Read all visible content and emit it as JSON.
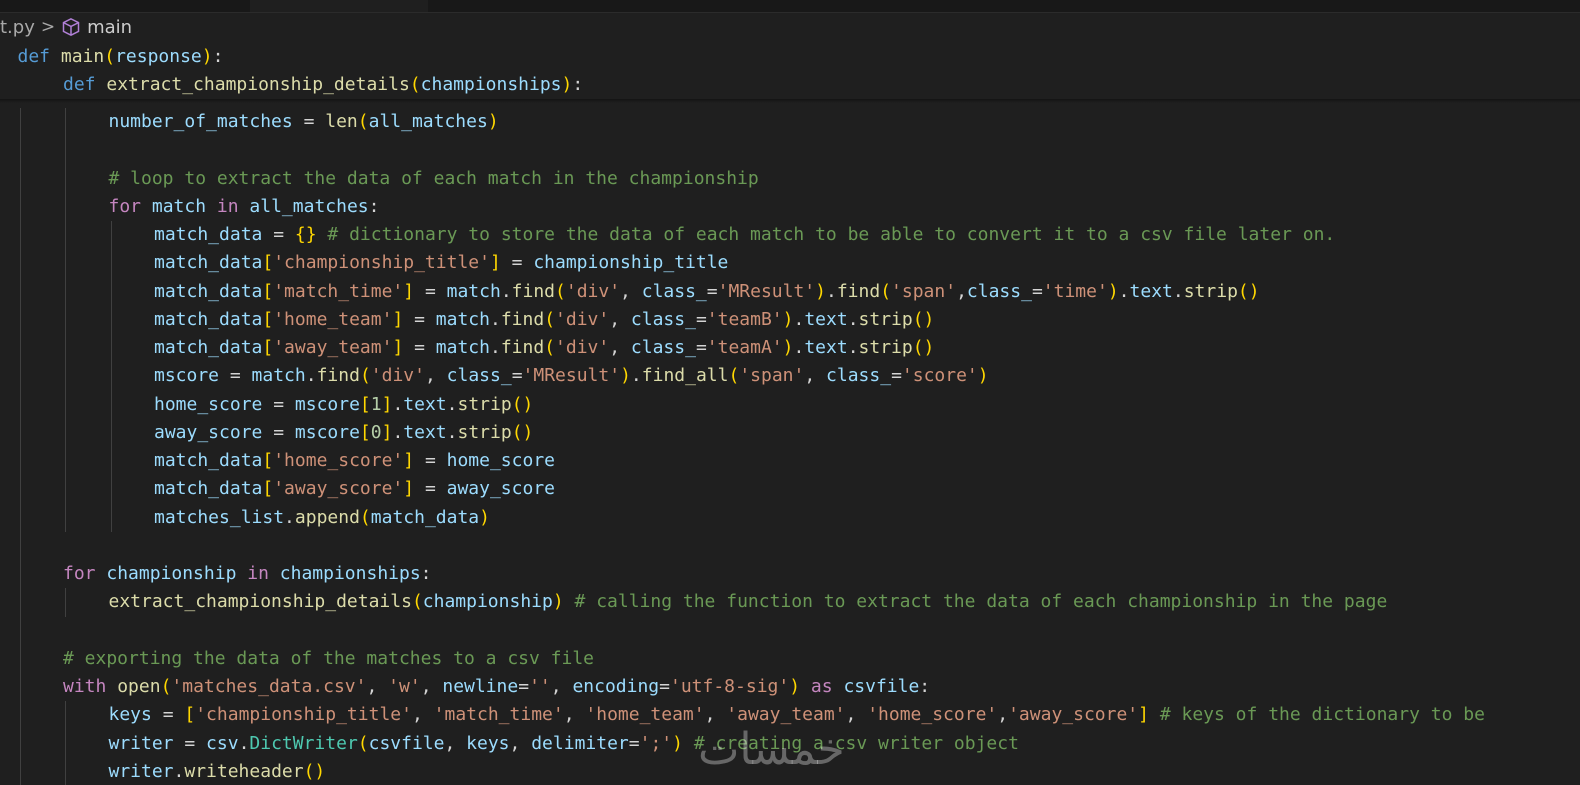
{
  "breadcrumb": {
    "file": "t.py",
    "symbol": "main",
    "separator": ">"
  },
  "colors": {
    "keyword": "#569cd6",
    "control": "#c586c0",
    "function": "#dcdcaa",
    "variable": "#9cdcfe",
    "string": "#ce9178",
    "comment": "#6a9955",
    "number": "#b5cea8",
    "bracket1": "#ffd700",
    "bracket2": "#da70d6",
    "class": "#4ec9b0",
    "background": "#1f1f1f"
  },
  "watermark": "خمسات",
  "sticky_lines": [
    {
      "indent": 1,
      "tokens": [
        [
          "kw",
          "def"
        ],
        [
          "op",
          " "
        ],
        [
          "fn",
          "main"
        ],
        [
          "p1",
          "("
        ],
        [
          "var",
          "response"
        ],
        [
          "p1",
          ")"
        ],
        [
          "op",
          ":"
        ]
      ]
    },
    {
      "indent": 2,
      "tokens": [
        [
          "kw",
          "def"
        ],
        [
          "op",
          " "
        ],
        [
          "fn",
          "extract_championship_details"
        ],
        [
          "p1",
          "("
        ],
        [
          "var",
          "championships"
        ],
        [
          "p1",
          ")"
        ],
        [
          "op",
          ":"
        ]
      ]
    }
  ],
  "code_lines": [
    {
      "indent": 3,
      "tokens": [
        [
          "var",
          "number_of_matches"
        ],
        [
          "op",
          " = "
        ],
        [
          "fn",
          "len"
        ],
        [
          "p1",
          "("
        ],
        [
          "var",
          "all_matches"
        ],
        [
          "p1",
          ")"
        ]
      ]
    },
    {
      "indent": 0,
      "tokens": []
    },
    {
      "indent": 3,
      "tokens": [
        [
          "cmt",
          "# loop to extract the data of each match in the championship"
        ]
      ]
    },
    {
      "indent": 3,
      "tokens": [
        [
          "ctl",
          "for"
        ],
        [
          "op",
          " "
        ],
        [
          "var",
          "match"
        ],
        [
          "op",
          " "
        ],
        [
          "ctl",
          "in"
        ],
        [
          "op",
          " "
        ],
        [
          "var",
          "all_matches"
        ],
        [
          "op",
          ":"
        ]
      ]
    },
    {
      "indent": 4,
      "tokens": [
        [
          "var",
          "match_data"
        ],
        [
          "op",
          " = "
        ],
        [
          "p1",
          "{}"
        ],
        [
          "op",
          " "
        ],
        [
          "cmt",
          "# dictionary to store the data of each match to be able to convert it to a csv file later on."
        ]
      ]
    },
    {
      "indent": 4,
      "tokens": [
        [
          "var",
          "match_data"
        ],
        [
          "p1",
          "["
        ],
        [
          "str",
          "'championship_title'"
        ],
        [
          "p1",
          "]"
        ],
        [
          "op",
          " = "
        ],
        [
          "var",
          "championship_title"
        ]
      ]
    },
    {
      "indent": 4,
      "tokens": [
        [
          "var",
          "match_data"
        ],
        [
          "p1",
          "["
        ],
        [
          "str",
          "'match_time'"
        ],
        [
          "p1",
          "]"
        ],
        [
          "op",
          " = "
        ],
        [
          "var",
          "match"
        ],
        [
          "op",
          "."
        ],
        [
          "fn",
          "find"
        ],
        [
          "p1",
          "("
        ],
        [
          "str",
          "'div'"
        ],
        [
          "op",
          ", "
        ],
        [
          "var",
          "class_"
        ],
        [
          "op",
          "="
        ],
        [
          "str",
          "'MResult'"
        ],
        [
          "p1",
          ")"
        ],
        [
          "op",
          "."
        ],
        [
          "fn",
          "find"
        ],
        [
          "p1",
          "("
        ],
        [
          "str",
          "'span'"
        ],
        [
          "op",
          ","
        ],
        [
          "var",
          "class_"
        ],
        [
          "op",
          "="
        ],
        [
          "str",
          "'time'"
        ],
        [
          "p1",
          ")"
        ],
        [
          "op",
          "."
        ],
        [
          "var",
          "text"
        ],
        [
          "op",
          "."
        ],
        [
          "fn",
          "strip"
        ],
        [
          "p1",
          "()"
        ]
      ]
    },
    {
      "indent": 4,
      "tokens": [
        [
          "var",
          "match_data"
        ],
        [
          "p1",
          "["
        ],
        [
          "str",
          "'home_team'"
        ],
        [
          "p1",
          "]"
        ],
        [
          "op",
          " = "
        ],
        [
          "var",
          "match"
        ],
        [
          "op",
          "."
        ],
        [
          "fn",
          "find"
        ],
        [
          "p1",
          "("
        ],
        [
          "str",
          "'div'"
        ],
        [
          "op",
          ", "
        ],
        [
          "var",
          "class_"
        ],
        [
          "op",
          "="
        ],
        [
          "str",
          "'teamB'"
        ],
        [
          "p1",
          ")"
        ],
        [
          "op",
          "."
        ],
        [
          "var",
          "text"
        ],
        [
          "op",
          "."
        ],
        [
          "fn",
          "strip"
        ],
        [
          "p1",
          "()"
        ]
      ]
    },
    {
      "indent": 4,
      "tokens": [
        [
          "var",
          "match_data"
        ],
        [
          "p1",
          "["
        ],
        [
          "str",
          "'away_team'"
        ],
        [
          "p1",
          "]"
        ],
        [
          "op",
          " = "
        ],
        [
          "var",
          "match"
        ],
        [
          "op",
          "."
        ],
        [
          "fn",
          "find"
        ],
        [
          "p1",
          "("
        ],
        [
          "str",
          "'div'"
        ],
        [
          "op",
          ", "
        ],
        [
          "var",
          "class_"
        ],
        [
          "op",
          "="
        ],
        [
          "str",
          "'teamA'"
        ],
        [
          "p1",
          ")"
        ],
        [
          "op",
          "."
        ],
        [
          "var",
          "text"
        ],
        [
          "op",
          "."
        ],
        [
          "fn",
          "strip"
        ],
        [
          "p1",
          "()"
        ]
      ]
    },
    {
      "indent": 4,
      "tokens": [
        [
          "var",
          "mscore"
        ],
        [
          "op",
          " = "
        ],
        [
          "var",
          "match"
        ],
        [
          "op",
          "."
        ],
        [
          "fn",
          "find"
        ],
        [
          "p1",
          "("
        ],
        [
          "str",
          "'div'"
        ],
        [
          "op",
          ", "
        ],
        [
          "var",
          "class_"
        ],
        [
          "op",
          "="
        ],
        [
          "str",
          "'MResult'"
        ],
        [
          "p1",
          ")"
        ],
        [
          "op",
          "."
        ],
        [
          "fn",
          "find_all"
        ],
        [
          "p1",
          "("
        ],
        [
          "str",
          "'span'"
        ],
        [
          "op",
          ", "
        ],
        [
          "var",
          "class_"
        ],
        [
          "op",
          "="
        ],
        [
          "str",
          "'score'"
        ],
        [
          "p1",
          ")"
        ]
      ]
    },
    {
      "indent": 4,
      "tokens": [
        [
          "var",
          "home_score"
        ],
        [
          "op",
          " = "
        ],
        [
          "var",
          "mscore"
        ],
        [
          "p1",
          "["
        ],
        [
          "num",
          "1"
        ],
        [
          "p1",
          "]"
        ],
        [
          "op",
          "."
        ],
        [
          "var",
          "text"
        ],
        [
          "op",
          "."
        ],
        [
          "fn",
          "strip"
        ],
        [
          "p1",
          "()"
        ]
      ]
    },
    {
      "indent": 4,
      "tokens": [
        [
          "var",
          "away_score"
        ],
        [
          "op",
          " = "
        ],
        [
          "var",
          "mscore"
        ],
        [
          "p1",
          "["
        ],
        [
          "num",
          "0"
        ],
        [
          "p1",
          "]"
        ],
        [
          "op",
          "."
        ],
        [
          "var",
          "text"
        ],
        [
          "op",
          "."
        ],
        [
          "fn",
          "strip"
        ],
        [
          "p1",
          "()"
        ]
      ]
    },
    {
      "indent": 4,
      "tokens": [
        [
          "var",
          "match_data"
        ],
        [
          "p1",
          "["
        ],
        [
          "str",
          "'home_score'"
        ],
        [
          "p1",
          "]"
        ],
        [
          "op",
          " = "
        ],
        [
          "var",
          "home_score"
        ]
      ]
    },
    {
      "indent": 4,
      "tokens": [
        [
          "var",
          "match_data"
        ],
        [
          "p1",
          "["
        ],
        [
          "str",
          "'away_score'"
        ],
        [
          "p1",
          "]"
        ],
        [
          "op",
          " = "
        ],
        [
          "var",
          "away_score"
        ]
      ]
    },
    {
      "indent": 4,
      "tokens": [
        [
          "var",
          "matches_list"
        ],
        [
          "op",
          "."
        ],
        [
          "fn",
          "append"
        ],
        [
          "p1",
          "("
        ],
        [
          "var",
          "match_data"
        ],
        [
          "p1",
          ")"
        ]
      ]
    },
    {
      "indent": 0,
      "tokens": []
    },
    {
      "indent": 2,
      "tokens": [
        [
          "ctl",
          "for"
        ],
        [
          "op",
          " "
        ],
        [
          "var",
          "championship"
        ],
        [
          "op",
          " "
        ],
        [
          "ctl",
          "in"
        ],
        [
          "op",
          " "
        ],
        [
          "var",
          "championships"
        ],
        [
          "op",
          ":"
        ]
      ]
    },
    {
      "indent": 3,
      "tokens": [
        [
          "fn",
          "extract_championship_details"
        ],
        [
          "p1",
          "("
        ],
        [
          "var",
          "championship"
        ],
        [
          "p1",
          ")"
        ],
        [
          "op",
          " "
        ],
        [
          "cmt",
          "# calling the function to extract the data of each championship in the page"
        ]
      ]
    },
    {
      "indent": 0,
      "tokens": []
    },
    {
      "indent": 2,
      "tokens": [
        [
          "cmt",
          "# exporting the data of the matches to a csv file"
        ]
      ]
    },
    {
      "indent": 2,
      "tokens": [
        [
          "ctl",
          "with"
        ],
        [
          "op",
          " "
        ],
        [
          "fn",
          "open"
        ],
        [
          "p1",
          "("
        ],
        [
          "str",
          "'matches_data.csv'"
        ],
        [
          "op",
          ", "
        ],
        [
          "str",
          "'w'"
        ],
        [
          "op",
          ", "
        ],
        [
          "var",
          "newline"
        ],
        [
          "op",
          "="
        ],
        [
          "str",
          "''"
        ],
        [
          "op",
          ", "
        ],
        [
          "var",
          "encoding"
        ],
        [
          "op",
          "="
        ],
        [
          "str",
          "'utf-8-sig'"
        ],
        [
          "p1",
          ")"
        ],
        [
          "op",
          " "
        ],
        [
          "ctl",
          "as"
        ],
        [
          "op",
          " "
        ],
        [
          "var",
          "csvfile"
        ],
        [
          "op",
          ":"
        ]
      ]
    },
    {
      "indent": 3,
      "tokens": [
        [
          "var",
          "keys"
        ],
        [
          "op",
          " = "
        ],
        [
          "p1",
          "["
        ],
        [
          "str",
          "'championship_title'"
        ],
        [
          "op",
          ", "
        ],
        [
          "str",
          "'match_time'"
        ],
        [
          "op",
          ", "
        ],
        [
          "str",
          "'home_team'"
        ],
        [
          "op",
          ", "
        ],
        [
          "str",
          "'away_team'"
        ],
        [
          "op",
          ", "
        ],
        [
          "str",
          "'home_score'"
        ],
        [
          "op",
          ","
        ],
        [
          "str",
          "'away_score'"
        ],
        [
          "p1",
          "]"
        ],
        [
          "op",
          " "
        ],
        [
          "cmt",
          "# keys of the dictionary to be"
        ]
      ]
    },
    {
      "indent": 3,
      "tokens": [
        [
          "var",
          "writer"
        ],
        [
          "op",
          " = "
        ],
        [
          "var",
          "csv"
        ],
        [
          "op",
          "."
        ],
        [
          "cls",
          "DictWriter"
        ],
        [
          "p1",
          "("
        ],
        [
          "var",
          "csvfile"
        ],
        [
          "op",
          ", "
        ],
        [
          "var",
          "keys"
        ],
        [
          "op",
          ", "
        ],
        [
          "var",
          "delimiter"
        ],
        [
          "op",
          "="
        ],
        [
          "str",
          "';'"
        ],
        [
          "p1",
          ")"
        ],
        [
          "op",
          " "
        ],
        [
          "cmt",
          "# creating a csv writer object"
        ]
      ]
    },
    {
      "indent": 3,
      "tokens": [
        [
          "var",
          "writer"
        ],
        [
          "op",
          "."
        ],
        [
          "fn",
          "writeheader"
        ],
        [
          "p1",
          "()"
        ]
      ]
    }
  ]
}
